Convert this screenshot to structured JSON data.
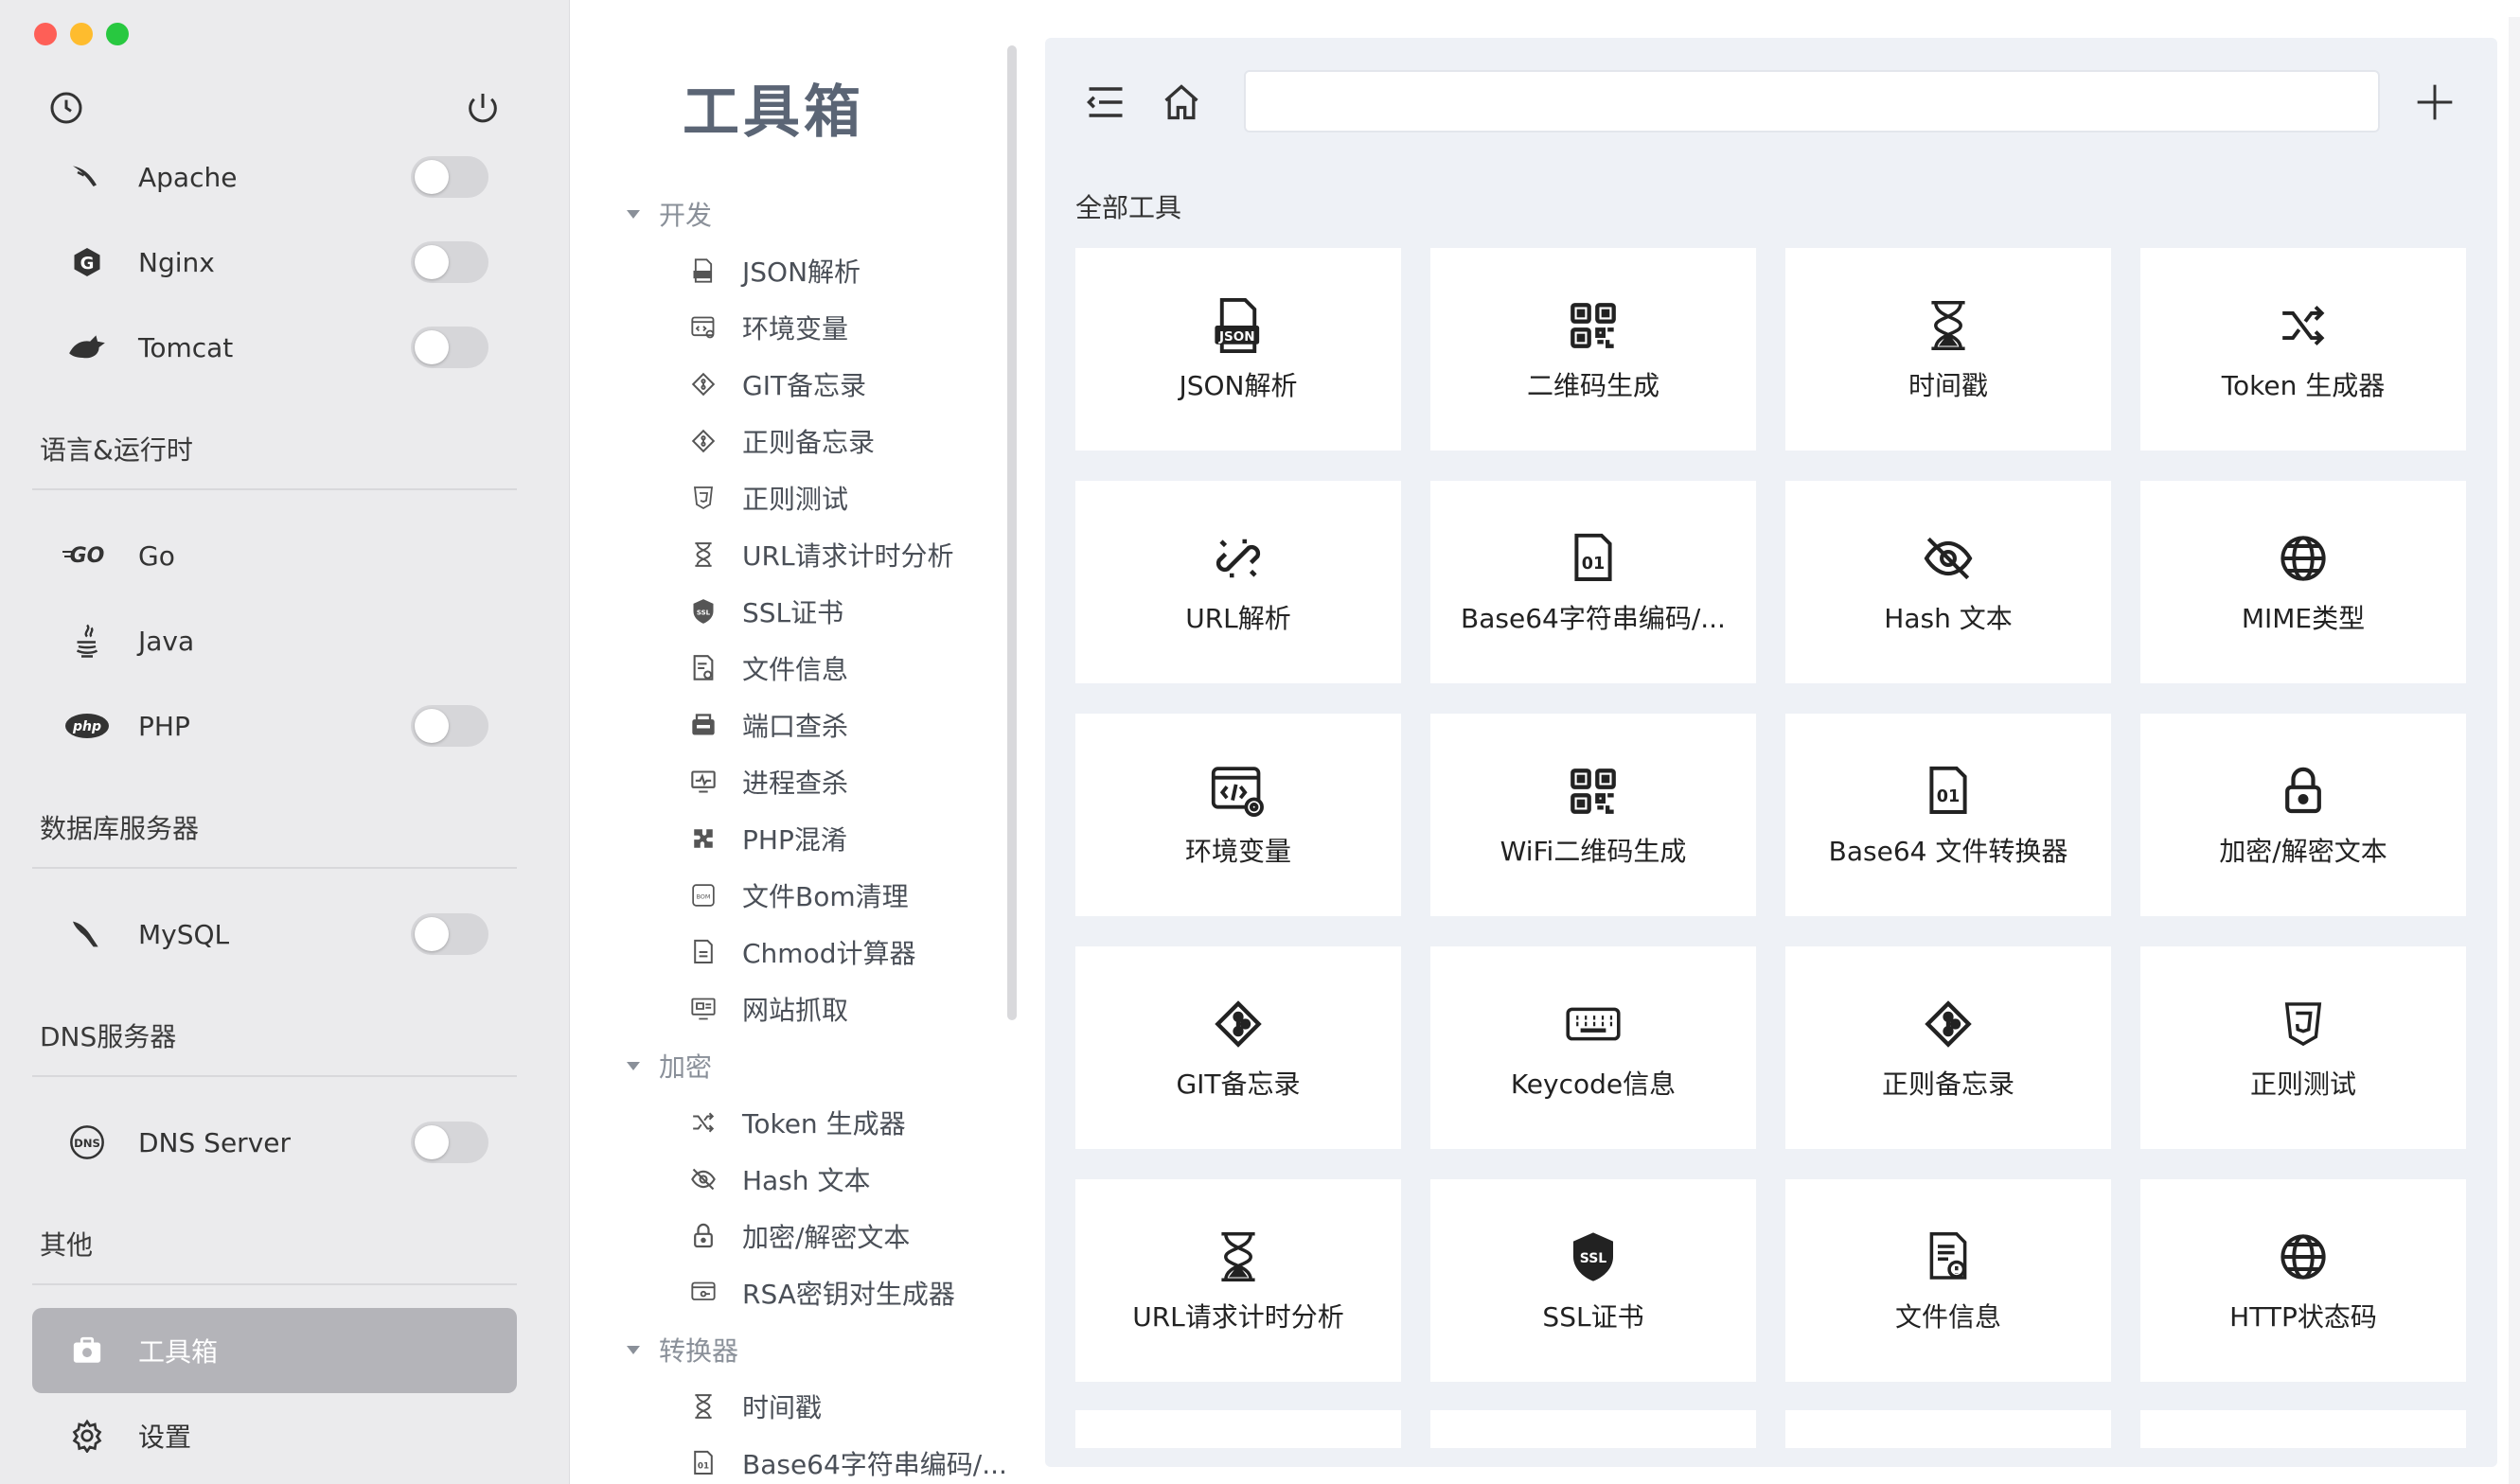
{
  "sidebar": {
    "services": [
      {
        "label": "Apache",
        "icon": "apache-feather-icon"
      },
      {
        "label": "Nginx",
        "icon": "nginx-icon"
      },
      {
        "label": "Tomcat",
        "icon": "tomcat-icon"
      }
    ],
    "sections": {
      "runtime": "语言&运行时",
      "database": "数据库服务器",
      "dns": "DNS服务器",
      "other": "其他"
    },
    "runtimes": [
      {
        "label": "Go",
        "icon": "go-icon"
      },
      {
        "label": "Java",
        "icon": "java-icon"
      },
      {
        "label": "PHP",
        "icon": "php-icon"
      }
    ],
    "db": {
      "label": "MySQL",
      "icon": "mysql-icon"
    },
    "dns": {
      "label": "DNS Server",
      "icon": "dns-icon"
    },
    "toolbox": {
      "label": "工具箱"
    },
    "settings": {
      "label": "设置"
    }
  },
  "middle": {
    "title": "工具箱",
    "groups": [
      {
        "label": "开发",
        "items": [
          "JSON解析",
          "环境变量",
          "GIT备忘录",
          "正则备忘录",
          "正则测试",
          "URL请求计时分析",
          "SSL证书",
          "文件信息",
          "端口查杀",
          "进程查杀",
          "PHP混淆",
          "文件Bom清理",
          "Chmod计算器",
          "网站抓取"
        ]
      },
      {
        "label": "加密",
        "items": [
          "Token 生成器",
          "Hash 文本",
          "加密/解密文本",
          "RSA密钥对生成器"
        ]
      },
      {
        "label": "转换器",
        "items": [
          "时间戳",
          "Base64字符串编码/..."
        ]
      }
    ]
  },
  "main": {
    "search_value": "",
    "section_title": "全部工具",
    "tools": [
      {
        "label": "JSON解析",
        "icon": "json-file-icon"
      },
      {
        "label": "二维码生成",
        "icon": "qrcode-icon"
      },
      {
        "label": "时间戳",
        "icon": "hourglass-icon"
      },
      {
        "label": "Token 生成器",
        "icon": "shuffle-icon"
      },
      {
        "label": "URL解析",
        "icon": "broken-link-icon"
      },
      {
        "label": "Base64字符串编码/...",
        "icon": "binary-file-icon"
      },
      {
        "label": "Hash 文本",
        "icon": "eye-off-icon"
      },
      {
        "label": "MIME类型",
        "icon": "globe-icon"
      },
      {
        "label": "环境变量",
        "icon": "code-settings-icon"
      },
      {
        "label": "WiFi二维码生成",
        "icon": "qrcode-icon"
      },
      {
        "label": "Base64 文件转换器",
        "icon": "binary-file-icon"
      },
      {
        "label": "加密/解密文本",
        "icon": "lock-icon"
      },
      {
        "label": "GIT备忘录",
        "icon": "git-icon"
      },
      {
        "label": "Keycode信息",
        "icon": "keyboard-icon"
      },
      {
        "label": "正则备忘录",
        "icon": "git-icon"
      },
      {
        "label": "正则测试",
        "icon": "html5-shield-icon"
      },
      {
        "label": "URL请求计时分析",
        "icon": "hourglass-icon"
      },
      {
        "label": "SSL证书",
        "icon": "ssl-badge-icon"
      },
      {
        "label": "文件信息",
        "icon": "file-info-icon"
      },
      {
        "label": "HTTP状态码",
        "icon": "globe-icon"
      }
    ]
  }
}
